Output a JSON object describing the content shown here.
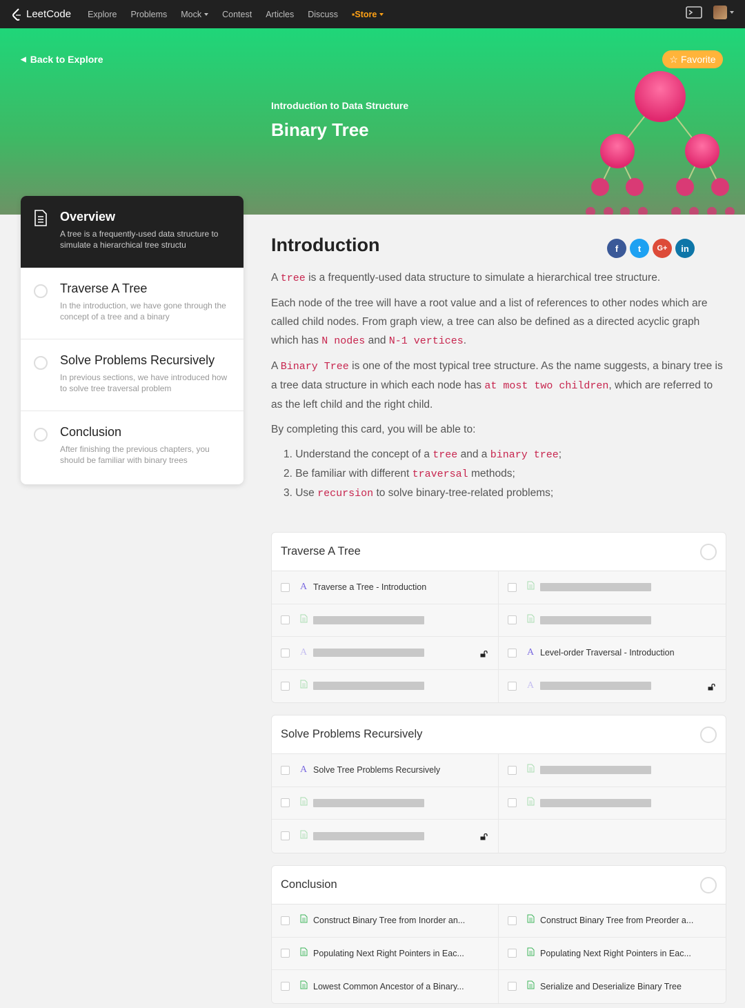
{
  "nav": {
    "logo_text": "LeetCode",
    "items": [
      "Explore",
      "Problems",
      "Mock",
      "Contest",
      "Articles",
      "Discuss",
      "Store"
    ]
  },
  "hero": {
    "back_label": "Back to Explore",
    "favorite_label": "Favorite",
    "subtitle": "Introduction to Data Structure",
    "title": "Binary Tree"
  },
  "sidebar": {
    "items": [
      {
        "title": "Overview",
        "desc": "A tree is a frequently-used data structure to simulate a hierarchical tree structu"
      },
      {
        "title": "Traverse A Tree",
        "desc": "In the introduction, we have gone through the concept of a tree and a binary"
      },
      {
        "title": "Solve Problems Recursively",
        "desc": "In previous sections, we have introduced how to solve tree traversal problem"
      },
      {
        "title": "Conclusion",
        "desc": "After finishing the previous chapters, you should be familiar with binary trees"
      }
    ]
  },
  "intro": {
    "title": "Introduction",
    "socials": [
      "f",
      "t",
      "G+",
      "in"
    ],
    "p1": {
      "a": "A",
      "code1": "tree",
      "b": "is a frequently-used data structure to simulate a hierarchical tree structure."
    },
    "p2": {
      "a": "Each node of the tree will have a root value and a list of references to other nodes which are called child nodes. From graph view, a tree can also be defined as a directed acyclic graph which has",
      "code1": "N nodes",
      "b": "and",
      "code2": "N-1 vertices",
      "c": "."
    },
    "p3": {
      "a": "A",
      "code1": "Binary Tree",
      "b": "is one of the most typical tree structure. As the name suggests, a binary tree is a tree data structure in which each node has",
      "code2": "at most two children",
      "c": ", which are referred to as the left child and the right child."
    },
    "p4": "By completing this card, you will be able to:",
    "l1": {
      "a": "1. Understand the concept of a",
      "code1": "tree",
      "b": "and a",
      "code2": "binary tree",
      "c": ";"
    },
    "l2": {
      "a": "2. Be familiar with different",
      "code1": "traversal",
      "b": "methods;"
    },
    "l3": {
      "a": "3. Use",
      "code1": "recursion",
      "b": "to solve binary-tree-related problems;"
    }
  },
  "sections": [
    {
      "title": "Traverse A Tree",
      "cells": [
        {
          "type": "article",
          "label": "Traverse a Tree - Introduction"
        },
        {
          "type": "doc",
          "label": ""
        },
        {
          "type": "doc",
          "label": ""
        },
        {
          "type": "doc",
          "label": ""
        },
        {
          "type": "article",
          "label": "",
          "locked": true
        },
        {
          "type": "article",
          "label": "Level-order Traversal - Introduction"
        },
        {
          "type": "doc",
          "label": ""
        },
        {
          "type": "article",
          "label": "",
          "locked": true
        }
      ]
    },
    {
      "title": "Solve Problems Recursively",
      "cells": [
        {
          "type": "article",
          "label": "Solve Tree Problems Recursively"
        },
        {
          "type": "doc",
          "label": ""
        },
        {
          "type": "doc",
          "label": ""
        },
        {
          "type": "doc",
          "label": ""
        },
        {
          "type": "doc",
          "label": "",
          "locked": true
        },
        {
          "type": "empty",
          "label": ""
        }
      ]
    },
    {
      "title": "Conclusion",
      "cells": [
        {
          "type": "doc",
          "label": "Construct Binary Tree from Inorder an..."
        },
        {
          "type": "doc",
          "label": "Construct Binary Tree from Preorder a..."
        },
        {
          "type": "doc",
          "label": "Populating Next Right Pointers in Eac..."
        },
        {
          "type": "doc",
          "label": "Populating Next Right Pointers in Eac..."
        },
        {
          "type": "doc",
          "label": "Lowest Common Ancestor of a Binary..."
        },
        {
          "type": "doc",
          "label": "Serialize and Deserialize Binary Tree"
        }
      ]
    }
  ]
}
